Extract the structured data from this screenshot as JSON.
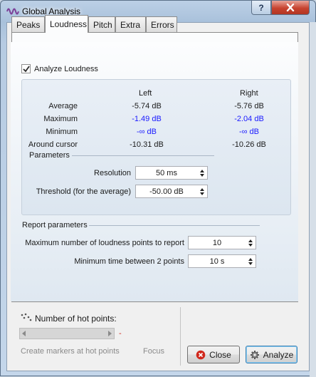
{
  "window": {
    "title": "Global Analysis"
  },
  "titlebar": {
    "help_label": "?"
  },
  "tabs": [
    {
      "label": "Peaks"
    },
    {
      "label": "Loudness"
    },
    {
      "label": "Pitch"
    },
    {
      "label": "Extra"
    },
    {
      "label": "Errors"
    }
  ],
  "active_tab": "Loudness",
  "analyze_loudness": {
    "label": "Analyze Loudness",
    "checked": true
  },
  "results": {
    "headers": {
      "left": "Left",
      "right": "Right"
    },
    "rows": [
      {
        "label": "Average",
        "left": "-5.74 dB",
        "right": "-5.76 dB",
        "color": "#1a1a1a"
      },
      {
        "label": "Maximum",
        "left": "-1.49 dB",
        "right": "-2.04 dB",
        "color": "#1a1aff"
      },
      {
        "label": "Minimum",
        "left": "-∞ dB",
        "right": "-∞ dB",
        "color": "#1a1aff"
      },
      {
        "label": "Around cursor",
        "left": "-10.31 dB",
        "right": "-10.26 dB",
        "color": "#1a1a1a"
      }
    ]
  },
  "parameters": {
    "title": "Parameters",
    "resolution": {
      "label": "Resolution",
      "value": "50 ms"
    },
    "threshold": {
      "label": "Threshold (for the average)",
      "value": "-50.00 dB"
    }
  },
  "report": {
    "title": "Report parameters",
    "max_points": {
      "label": "Maximum number of loudness points to report",
      "value": "10"
    },
    "min_time": {
      "label": "Minimum time between 2 points",
      "value": "10 s"
    }
  },
  "hot_points": {
    "label": "Number of hot points:",
    "value": "-",
    "create_markers_label": "Create markers at hot points",
    "focus_label": "Focus"
  },
  "buttons": {
    "close": "Close",
    "analyze": "Analyze"
  },
  "colors": {
    "accent_blue": "#1a1aff",
    "close_icon": "#d0281c",
    "checkmark": "#2a2a2a"
  }
}
